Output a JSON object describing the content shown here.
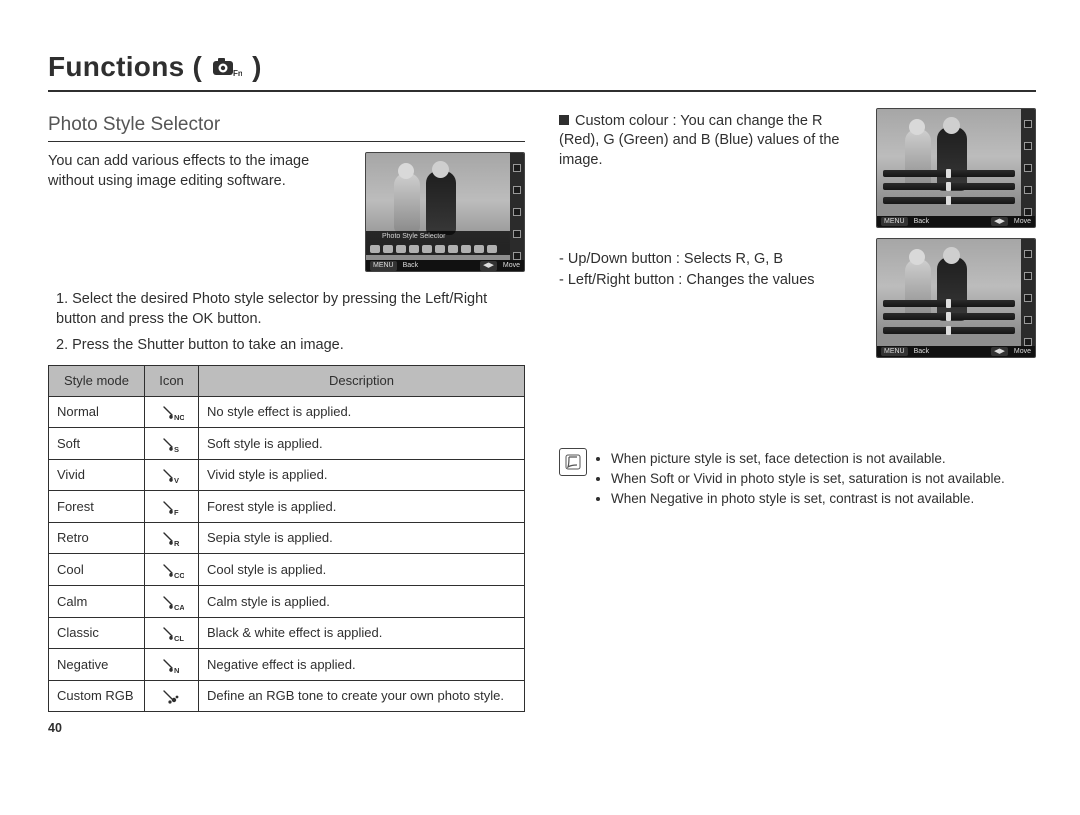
{
  "page_number": "40",
  "heading": {
    "title": "Functions (",
    "title_close": ")",
    "icon": "camera-fn-icon"
  },
  "section_title": "Photo Style Selector",
  "intro": "You can add various effects to the image without using image editing software.",
  "steps": {
    "s1": "1. Select the desired Photo style selector by pressing the Left/Right button and press the OK button.",
    "s2": "2. Press the Shutter button to take an image."
  },
  "shot1": {
    "overlay": "Photo Style Selector",
    "back": "Back",
    "move": "Move"
  },
  "table": {
    "headers": {
      "mode": "Style mode",
      "icon": "Icon",
      "desc": "Description"
    },
    "rows": [
      {
        "mode": "Normal",
        "icon": "NOR",
        "desc": "No style effect is applied."
      },
      {
        "mode": "Soft",
        "icon": "S",
        "desc": "Soft style is applied."
      },
      {
        "mode": "Vivid",
        "icon": "V",
        "desc": "Vivid style is applied."
      },
      {
        "mode": "Forest",
        "icon": "F",
        "desc": "Forest style is applied."
      },
      {
        "mode": "Retro",
        "icon": "R",
        "desc": "Sepia style is applied."
      },
      {
        "mode": "Cool",
        "icon": "CO",
        "desc": "Cool style is applied."
      },
      {
        "mode": "Calm",
        "icon": "CA",
        "desc": "Calm style is applied."
      },
      {
        "mode": "Classic",
        "icon": "CL",
        "desc": "Black & white effect is applied."
      },
      {
        "mode": "Negative",
        "icon": "N",
        "desc": "Negative effect is applied."
      },
      {
        "mode": "Custom RGB",
        "icon": "RGB",
        "desc": "Define an RGB tone to create your own photo style."
      }
    ]
  },
  "custom": {
    "label": "Custom colour : You can change the R (Red), G (Green) and B (Blue) values of the image.",
    "line1": "- Up/Down button : Selects R, G, B",
    "line2": "- Left/Right button : Changes the values"
  },
  "shot_footer": {
    "back": "Back",
    "move": "Move"
  },
  "notes": {
    "n1": "When picture style is set, face detection is not available.",
    "n2": "When Soft or Vivid in photo style is set, saturation is not available.",
    "n3": "When Negative in photo style is set, contrast is not available."
  }
}
